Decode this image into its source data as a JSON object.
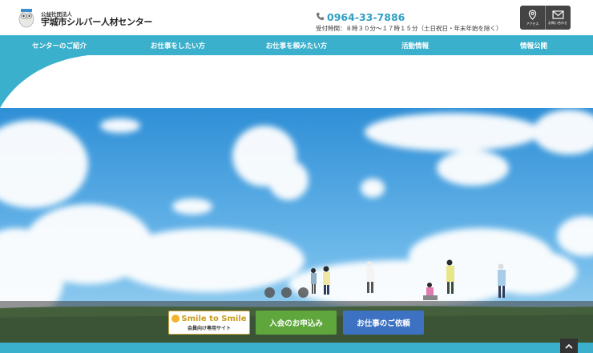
{
  "header": {
    "org_type": "公益社団法人",
    "org_name": "宇城市シルバー人材センター",
    "phone": "0964-33-7886",
    "hours": "受付時間：８時３０分～１７時１５分（土日祝日・年末年始を除く）",
    "buttons": [
      {
        "label": "アクセス",
        "icon": "map-pin-icon"
      },
      {
        "label": "お問い合わせ",
        "icon": "mail-icon"
      }
    ]
  },
  "nav": {
    "items": [
      "センターのご紹介",
      "お仕事をしたい方",
      "お仕事を頼みたい方",
      "活動情報",
      "情報公開"
    ]
  },
  "hero": {
    "slides_count": 3
  },
  "cta": {
    "smile_title": "Smile to Smile",
    "smile_sub": "会員向け専用サイト",
    "join": "入会のお申込み",
    "job": "お仕事のご依頼"
  },
  "colors": {
    "accent": "#3ab0cc",
    "phone": "#2f9fc4",
    "join": "#5fa73c",
    "job": "#3d72c3"
  }
}
